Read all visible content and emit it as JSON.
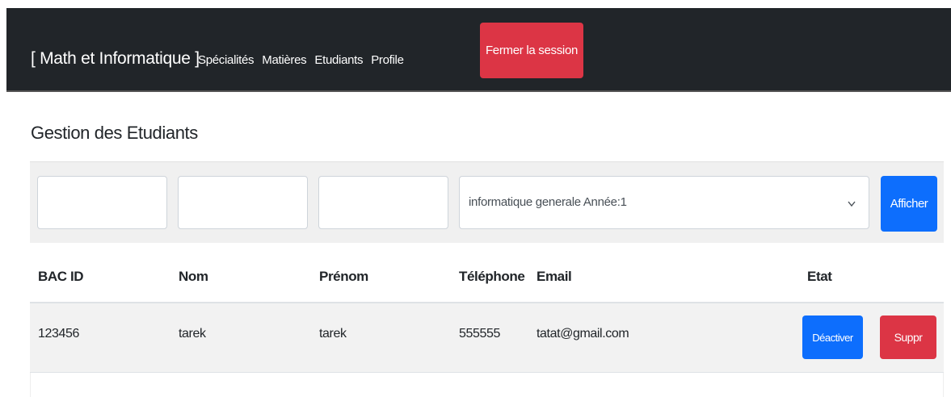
{
  "navbar": {
    "brand": "[ Math et Informatique ]",
    "links": [
      "Spécialités",
      "Matières",
      "Etudiants",
      "Profile"
    ],
    "logout_label": "Fermer la session"
  },
  "page": {
    "title": "Gestion des Etudiants"
  },
  "filters": {
    "inputs": [
      "",
      "",
      ""
    ],
    "select_value": "informatique generale Année:1",
    "show_label": "Afficher"
  },
  "table": {
    "headers": [
      "BAC ID",
      "Nom",
      "Prénom",
      "Téléphone",
      "Email",
      "Etat"
    ],
    "rows": [
      {
        "bac_id": "123456",
        "nom": "tarek",
        "prenom": "tarek",
        "telephone": "555555",
        "email": "tatat@gmail.com",
        "deactivate_label": "Déactiver",
        "delete_label": "Suppr"
      }
    ]
  },
  "colors": {
    "navbar_bg": "#212529",
    "danger": "#dc3545",
    "primary": "#0d6efd"
  },
  "icons": {
    "select_arrow": "chevron-down-icon"
  }
}
